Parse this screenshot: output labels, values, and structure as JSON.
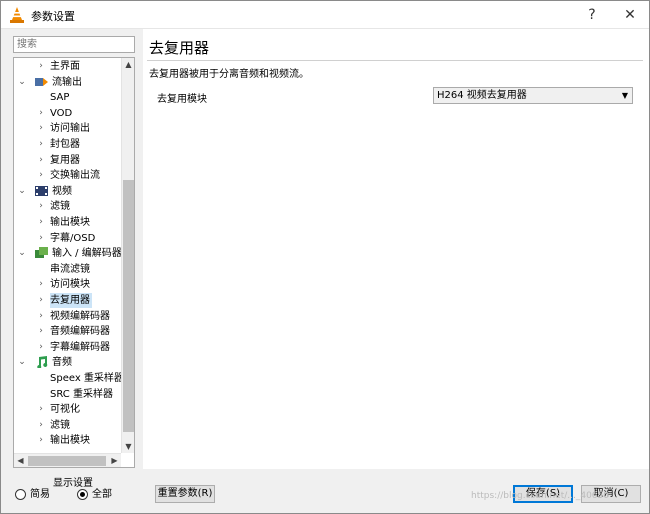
{
  "window": {
    "title": "参数设置",
    "help_icon": "?",
    "close_icon": "✕"
  },
  "search": {
    "placeholder": "搜索"
  },
  "tree": [
    {
      "label": "主界面",
      "expander": "›",
      "indent": 1,
      "selected": false
    },
    {
      "label": "流输出",
      "expander": "⌄",
      "indent": 0,
      "icon": "stream-output-icon",
      "selected": false
    },
    {
      "label": "SAP",
      "expander": "",
      "indent": 1,
      "selected": false
    },
    {
      "label": "VOD",
      "expander": "›",
      "indent": 1,
      "selected": false
    },
    {
      "label": "访问输出",
      "expander": "›",
      "indent": 1,
      "selected": false
    },
    {
      "label": "封包器",
      "expander": "›",
      "indent": 1,
      "selected": false
    },
    {
      "label": "复用器",
      "expander": "›",
      "indent": 1,
      "selected": false
    },
    {
      "label": "交换输出流",
      "expander": "›",
      "indent": 1,
      "selected": false
    },
    {
      "label": "视频",
      "expander": "⌄",
      "indent": 0,
      "icon": "video-icon",
      "selected": false
    },
    {
      "label": "滤镜",
      "expander": "›",
      "indent": 1,
      "selected": false
    },
    {
      "label": "输出模块",
      "expander": "›",
      "indent": 1,
      "selected": false
    },
    {
      "label": "字幕/OSD",
      "expander": "›",
      "indent": 1,
      "selected": false
    },
    {
      "label": "输入 / 编解码器",
      "expander": "⌄",
      "indent": 0,
      "icon": "codec-icon",
      "selected": false
    },
    {
      "label": "串流滤镜",
      "expander": "",
      "indent": 1,
      "selected": false
    },
    {
      "label": "访问模块",
      "expander": "›",
      "indent": 1,
      "selected": false
    },
    {
      "label": "去复用器",
      "expander": "›",
      "indent": 1,
      "selected": true
    },
    {
      "label": "视频编解码器",
      "expander": "›",
      "indent": 1,
      "selected": false
    },
    {
      "label": "音频编解码器",
      "expander": "›",
      "indent": 1,
      "selected": false
    },
    {
      "label": "字幕编解码器",
      "expander": "›",
      "indent": 1,
      "selected": false
    },
    {
      "label": "音频",
      "expander": "⌄",
      "indent": 0,
      "icon": "audio-icon",
      "selected": false
    },
    {
      "label": "Speex 重采样器",
      "expander": "",
      "indent": 1,
      "selected": false
    },
    {
      "label": "SRC 重采样器",
      "expander": "",
      "indent": 1,
      "selected": false
    },
    {
      "label": "可视化",
      "expander": "›",
      "indent": 1,
      "selected": false
    },
    {
      "label": "滤镜",
      "expander": "›",
      "indent": 1,
      "selected": false
    },
    {
      "label": "输出模块",
      "expander": "›",
      "indent": 1,
      "selected": false
    }
  ],
  "display": {
    "label": "显示设置",
    "simple": "简易",
    "all": "全部",
    "selected": "all"
  },
  "panel": {
    "heading": "去复用器",
    "description": "去复用器被用于分离音频和视频流。",
    "setting_label": "去复用模块",
    "dropdown_value": "H264 视频去复用器"
  },
  "buttons": {
    "reset": "重置参数(R)",
    "save": "保存(S)",
    "cancel": "取消(C)"
  },
  "watermark": "https://blog.csdn.net/..._40650"
}
